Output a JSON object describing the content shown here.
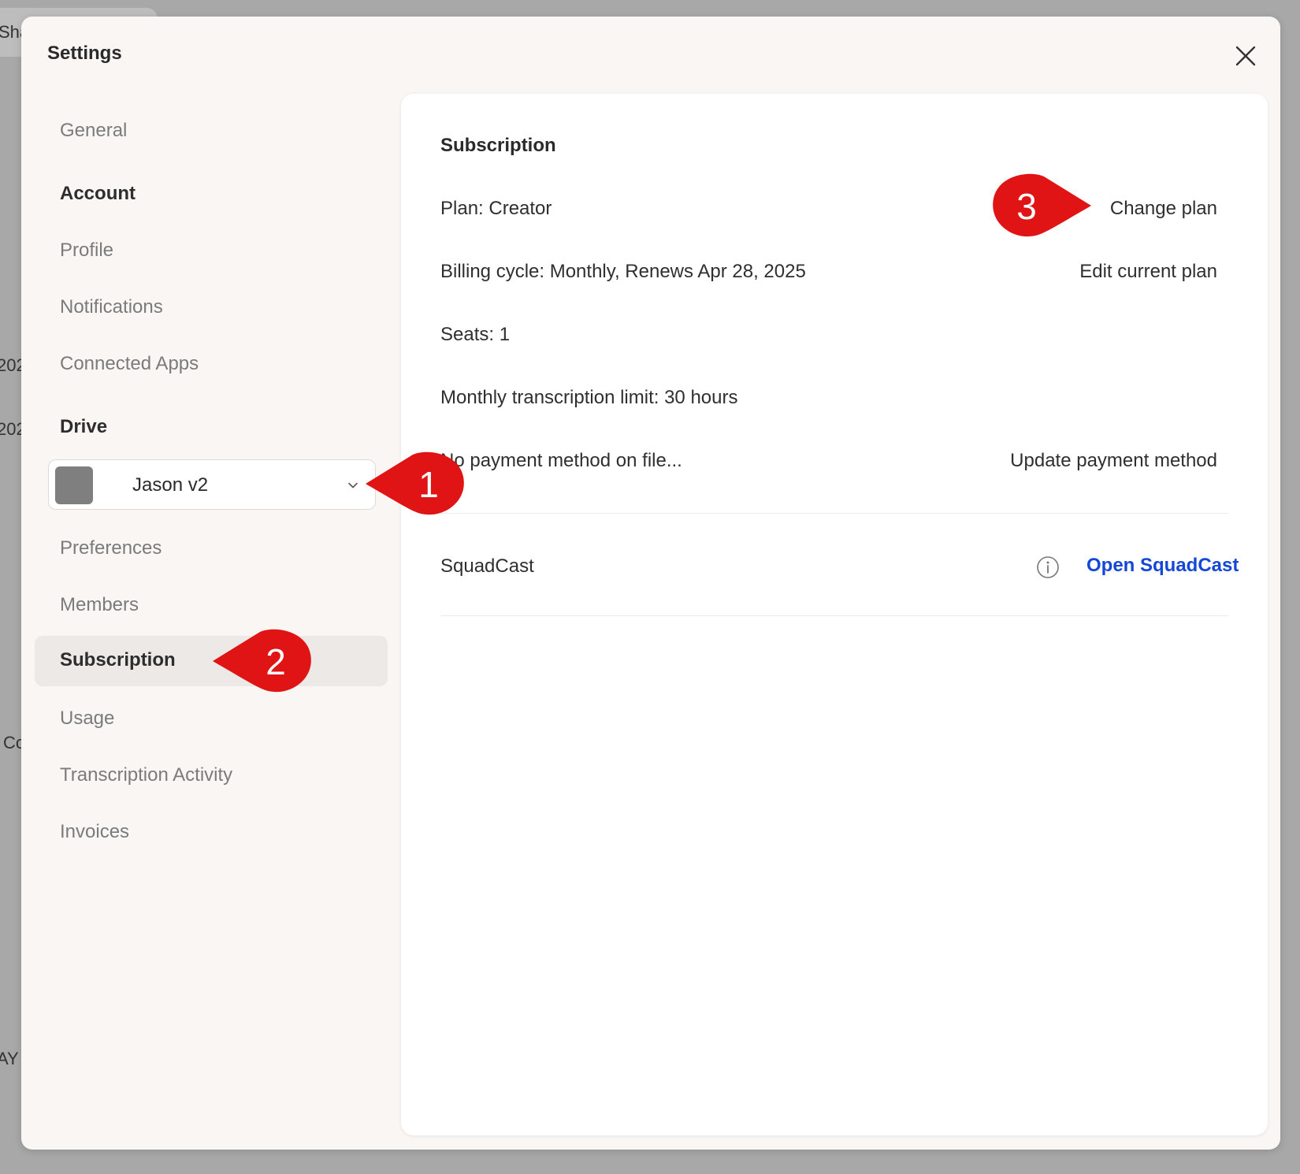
{
  "background": {
    "fragments": [
      "Sha",
      "202",
      "202",
      "Co",
      "AY"
    ]
  },
  "modal": {
    "title": "Settings"
  },
  "sidebar": {
    "general": "General",
    "account_heading": "Account",
    "profile": "Profile",
    "notifications": "Notifications",
    "connected_apps": "Connected Apps",
    "drive_heading": "Drive",
    "drive_select_value": "Jason v2",
    "preferences": "Preferences",
    "members": "Members",
    "subscription": "Subscription",
    "usage": "Usage",
    "transcription_activity": "Transcription Activity",
    "invoices": "Invoices"
  },
  "panel": {
    "title": "Subscription",
    "plan": "Plan: Creator",
    "change_plan": "Change plan",
    "billing": "Billing cycle: Monthly, Renews Apr 28, 2025",
    "edit_plan": "Edit current plan",
    "seats": "Seats: 1",
    "limit": "Monthly transcription limit: 30 hours",
    "payment": "No payment method on file...",
    "update_payment": "Update payment method",
    "squadcast": "SquadCast",
    "open_squadcast": "Open SquadCast"
  },
  "annotations": {
    "marker1": "1",
    "marker2": "2",
    "marker3": "3"
  },
  "colors": {
    "accent_link": "#1447d6",
    "marker_red": "#e01414"
  }
}
